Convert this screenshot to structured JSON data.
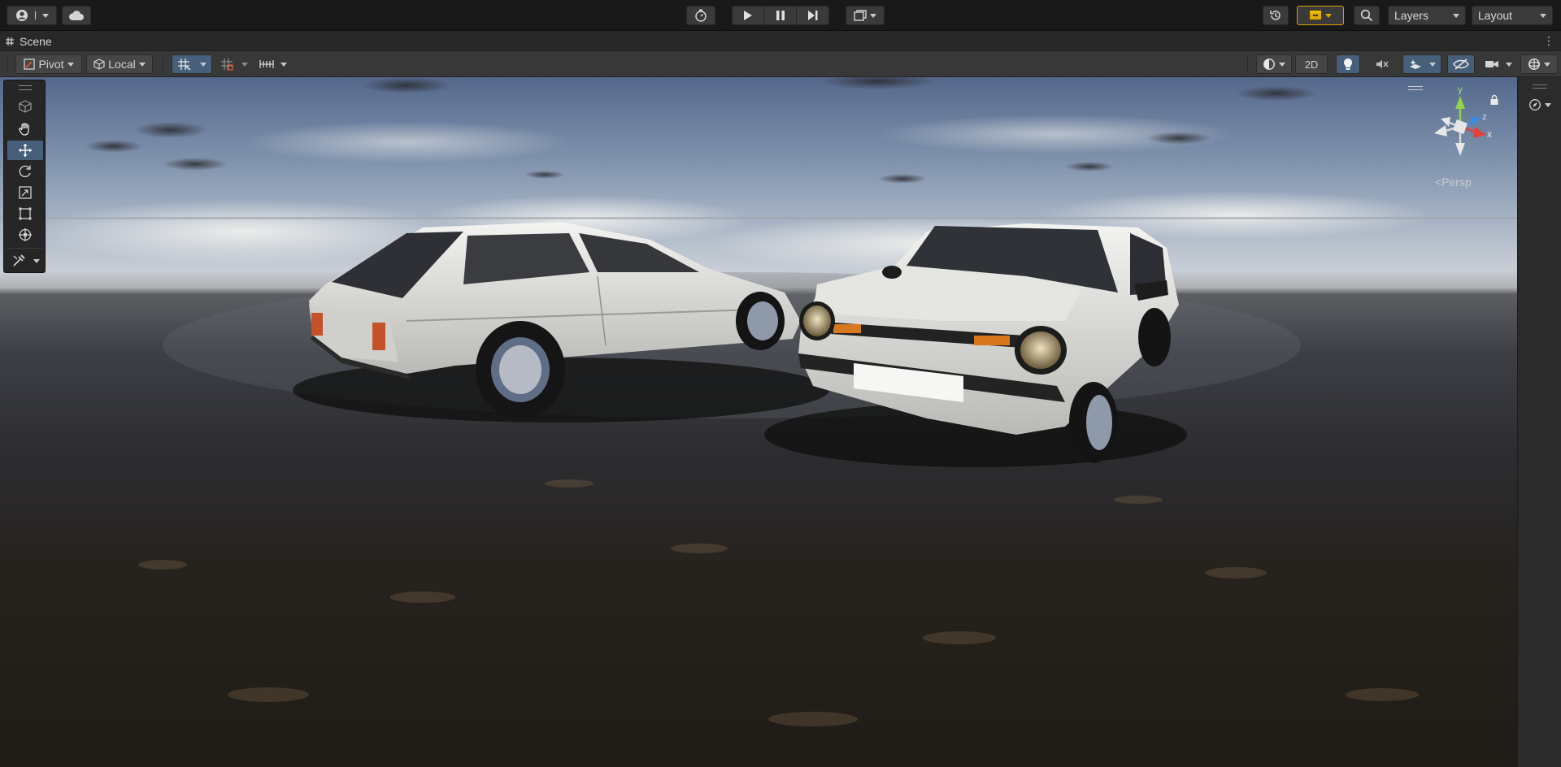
{
  "toolbar": {
    "layers_label": "Layers",
    "layout_label": "Layout"
  },
  "window": {
    "tab_title": "Scene",
    "tab_menu": "⋮"
  },
  "scene_toolbar": {
    "pivot_label": "Pivot",
    "local_label": "Local",
    "mode_2d_label": "2D"
  },
  "viewport": {
    "projection_label": "Persp",
    "axis_y": "y",
    "axis_z": "z",
    "axis_x": "x"
  },
  "colors": {
    "accent_active": "#46607c",
    "collab_border": "#d7a100",
    "axis_x": "#e2413a",
    "axis_y": "#8fd44a",
    "axis_z": "#3d8be0"
  },
  "icons": [
    "account-icon",
    "cloud-icon",
    "play-icon",
    "pause-icon",
    "step-icon",
    "history-icon",
    "search-icon",
    "hand-icon",
    "move-icon",
    "rotate-icon",
    "scale-icon",
    "rect-icon",
    "transform-icon",
    "lock-icon"
  ]
}
